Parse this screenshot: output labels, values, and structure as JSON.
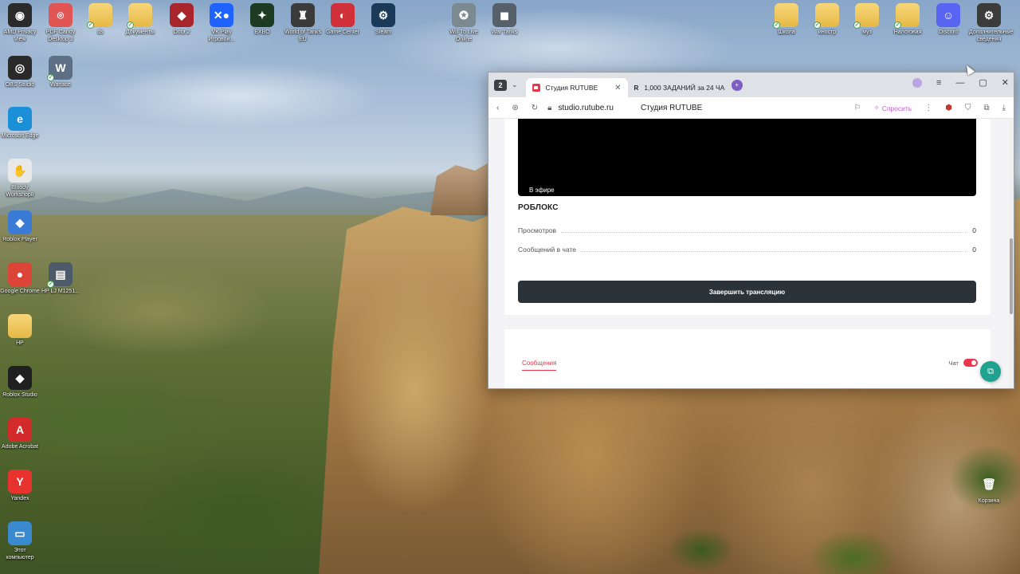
{
  "desktop": {
    "icons": [
      {
        "label": "AMD Privacy View",
        "glyph": "◉",
        "color": "#2b2b2b",
        "name": "amd-privacy-view-icon",
        "checked": false
      },
      {
        "label": "PDF Candy Desktop 3",
        "glyph": "⌾",
        "color": "#e25555",
        "name": "pdf-candy-icon",
        "checked": false
      },
      {
        "label": "ds",
        "glyph": "",
        "color": "folder",
        "name": "folder-ds-icon",
        "checked": true
      },
      {
        "label": "Документы",
        "glyph": "",
        "color": "folder",
        "name": "folder-documents-icon",
        "checked": true
      },
      {
        "label": "Dota 2",
        "glyph": "◆",
        "color": "#a8262b",
        "name": "dota2-icon",
        "checked": false
      },
      {
        "label": "VK Play Игровой...",
        "glyph": "✕●",
        "color": "#1e63ff",
        "name": "vk-play-icon",
        "checked": false
      },
      {
        "label": "EXBO",
        "glyph": "✦",
        "color": "#1d3a22",
        "name": "exbo-icon",
        "checked": false
      },
      {
        "label": "World of Tanks EU",
        "glyph": "♜",
        "color": "#3a3a3a",
        "name": "world-of-tanks-icon",
        "checked": false
      },
      {
        "label": "Game Center",
        "glyph": "◐",
        "color": "#d0303a",
        "name": "game-center-icon",
        "checked": false
      },
      {
        "label": "Steam",
        "glyph": "⚙",
        "color": "#1b3a5a",
        "name": "steam-icon",
        "checked": false
      },
      {
        "label": "Will To Live Online",
        "glyph": "✪",
        "color": "#7a8a90",
        "name": "will-to-live-icon",
        "checked": false
      },
      {
        "label": "War Tanks",
        "glyph": "◼",
        "color": "#56606a",
        "name": "war-tanks-icon",
        "checked": false
      },
      {
        "label": "OBS Studio",
        "glyph": "◎",
        "color": "#2a2a2a",
        "name": "obs-studio-icon",
        "checked": false
      },
      {
        "label": "Warface",
        "glyph": "W",
        "color": "#5c6f85",
        "name": "warface-icon",
        "checked": true
      },
      {
        "label": "Microsoft Edge",
        "glyph": "e",
        "color": "#1b8fd8",
        "name": "microsoft-edge-icon",
        "checked": false
      },
      {
        "label": "Bloody Workshop8",
        "glyph": "✋",
        "color": "#e8e8e8",
        "name": "bloody-workshop-icon",
        "checked": false
      },
      {
        "label": "Roblox Player",
        "glyph": "◆",
        "color": "#3a7bd5",
        "name": "roblox-player-icon",
        "checked": false
      },
      {
        "label": "Google Chrome",
        "glyph": "●",
        "color": "#db4437",
        "name": "google-chrome-icon",
        "checked": false
      },
      {
        "label": "HP LJ M1251...",
        "glyph": "▤",
        "color": "#4d5a6a",
        "name": "hp-printer-icon",
        "checked": true
      },
      {
        "label": "HP",
        "glyph": "",
        "color": "folder",
        "name": "folder-hp-icon",
        "checked": false
      },
      {
        "label": "Roblox Studio",
        "glyph": "◆",
        "color": "#202020",
        "name": "roblox-studio-icon",
        "checked": false
      },
      {
        "label": "Adobe Acrobat",
        "glyph": "A",
        "color": "#d32b2b",
        "name": "adobe-acrobat-icon",
        "checked": false
      },
      {
        "label": "Yandex",
        "glyph": "Y",
        "color": "#e8322e",
        "name": "yandex-icon",
        "checked": false
      },
      {
        "label": "Этот компьютер",
        "glyph": "▭",
        "color": "#3a8ad0",
        "name": "this-pc-icon",
        "checked": false
      },
      {
        "label": "Школа",
        "glyph": "",
        "color": "folder",
        "name": "folder-school-icon",
        "checked": true
      },
      {
        "label": "иностр",
        "glyph": "",
        "color": "folder",
        "name": "folder-inostr-icon",
        "checked": true
      },
      {
        "label": "муз",
        "glyph": "",
        "color": "folder",
        "name": "folder-muz-icon",
        "checked": true
      },
      {
        "label": "Налоговая",
        "glyph": "",
        "color": "folder",
        "name": "folder-tax-icon",
        "checked": true
      },
      {
        "label": "Discord",
        "glyph": "☺",
        "color": "#5865f2",
        "name": "discord-icon",
        "checked": false
      },
      {
        "label": "Дополнительные сведения",
        "glyph": "⚙",
        "color": "#3b3b3b",
        "name": "additional-info-icon",
        "checked": false
      },
      {
        "label": "Корзина",
        "glyph": "🗑",
        "color": "transparent",
        "name": "recycle-bin-icon",
        "checked": false
      }
    ]
  },
  "browser": {
    "workspace_number": "2",
    "tabs": [
      {
        "label": "Студия RUTUBE",
        "active": true
      },
      {
        "label": "1,000 ЗАДАНИЙ за 24 ЧА",
        "active": false
      }
    ],
    "url_domain": "studio.rutube.ru",
    "page_title": "Студия RUTUBE",
    "ask_label": "Спросить"
  },
  "stream": {
    "live_label": "В эфире",
    "name": "РОБЛОКС",
    "stats": [
      {
        "label": "Просмотров",
        "value": "0"
      },
      {
        "label": "Сообщений в чате",
        "value": "0"
      }
    ],
    "end_button_label": "Завершить трансляцию"
  },
  "chat_panel": {
    "messages_tab": "Сообщения",
    "chat_label": "Чат",
    "chat_enabled": true
  },
  "colors": {
    "accent": "#e8374d",
    "end_button": "#2c3338",
    "float_button": "#1fa28f"
  }
}
